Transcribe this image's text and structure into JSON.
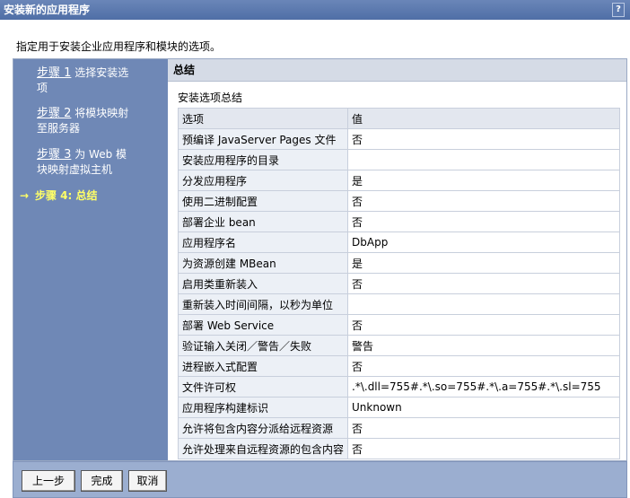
{
  "window": {
    "title": "安装新的应用程序",
    "help": "?"
  },
  "instruction": "指定用于安装企业应用程序和模块的选项。",
  "steps": [
    {
      "num": "步骤 1",
      "label": "选择安装选",
      "cont": "项"
    },
    {
      "num": "步骤 2",
      "label": "将模块映射",
      "cont": "至服务器"
    },
    {
      "num": "步骤 3",
      "label": "为 Web 模",
      "cont": "块映射虚拟主机"
    },
    {
      "arrow": "→",
      "label": "步骤 4: 总结"
    }
  ],
  "main": {
    "header": "总结",
    "section_title": "安装选项总结",
    "columns": [
      "选项",
      "值"
    ],
    "rows": [
      {
        "option": "预编译 JavaServer Pages 文件",
        "value": "否"
      },
      {
        "option": "安装应用程序的目录",
        "value": ""
      },
      {
        "option": "分发应用程序",
        "value": "是"
      },
      {
        "option": "使用二进制配置",
        "value": "否"
      },
      {
        "option": "部署企业 bean",
        "value": "否"
      },
      {
        "option": "应用程序名",
        "value": "DbApp"
      },
      {
        "option": "为资源创建 MBean",
        "value": "是"
      },
      {
        "option": "启用类重新装入",
        "value": "否"
      },
      {
        "option": "重新装入时间间隔，以秒为单位",
        "value": ""
      },
      {
        "option": "部署 Web Service",
        "value": "否"
      },
      {
        "option": "验证输入关闭／警告／失败",
        "value": "警告"
      },
      {
        "option": "进程嵌入式配置",
        "value": "否"
      },
      {
        "option": "文件许可权",
        "value": ".*\\.dll=755#.*\\.so=755#.*\\.a=755#.*\\.sl=755"
      },
      {
        "option": "应用程序构建标识",
        "value": "Unknown"
      },
      {
        "option": "允许将包含内容分派给远程资源",
        "value": "否"
      },
      {
        "option": "允许处理来自远程资源的包含内容",
        "value": "否"
      }
    ]
  },
  "buttons": {
    "prev": "上一步",
    "finish": "完成",
    "cancel": "取消"
  }
}
